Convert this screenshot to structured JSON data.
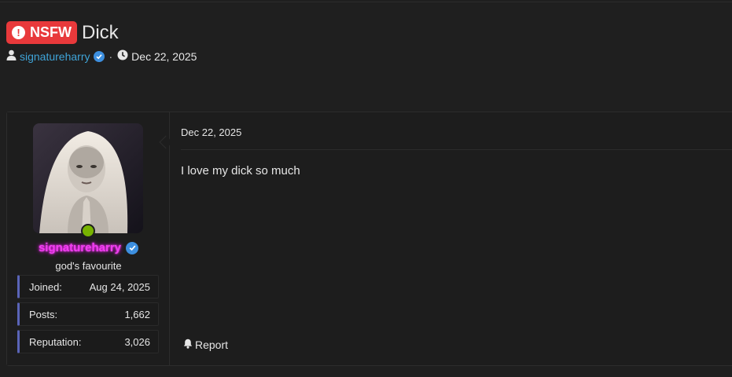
{
  "thread": {
    "badge": "NSFW",
    "title": "Dick",
    "author": "signatureharry",
    "date": "Dec 22, 2025"
  },
  "post": {
    "date": "Dec 22, 2025",
    "body": "I love my dick so much",
    "report_label": "Report"
  },
  "user": {
    "name": "signatureharry",
    "title": "god's favourite",
    "status": "online",
    "stats": [
      {
        "label": "Joined:",
        "value": "Aug 24, 2025"
      },
      {
        "label": "Posts:",
        "value": "1,662"
      },
      {
        "label": "Reputation:",
        "value": "3,026"
      }
    ]
  },
  "colors": {
    "background": "#1f1f1f",
    "nsfw_badge": "#e8393b",
    "author_link": "#3fa4d8",
    "username_glow": "#ff00ff",
    "online": "#77b300",
    "stat_accent": "#5a64b8",
    "verified": "#3d8fdf"
  },
  "icons": {
    "nsfw": "exclamation-circle-icon",
    "author": "user-icon",
    "verified": "verified-check-icon",
    "date": "clock-icon",
    "report": "bell-icon"
  }
}
